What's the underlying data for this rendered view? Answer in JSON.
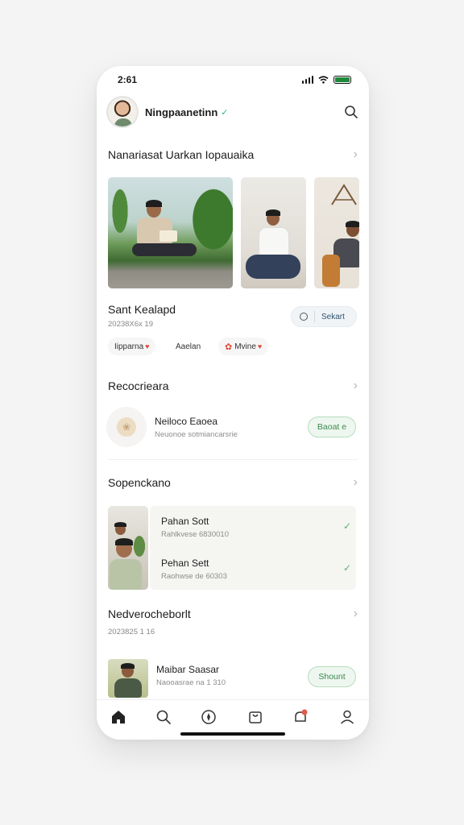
{
  "status_bar": {
    "time": "2:61"
  },
  "profile": {
    "name": "Ningpaanetinn",
    "verified_mark": "✓"
  },
  "section1": {
    "title": "Nanariasat Uarkan Iopauaika"
  },
  "event": {
    "title": "Sant Kealapd",
    "date": "20238X6x 19",
    "select_label": "Sekart"
  },
  "chips": [
    {
      "label": "Iipparna",
      "heart": "♥"
    },
    {
      "label": "Aaelan"
    },
    {
      "label": "Mvine",
      "heart": "♥"
    }
  ],
  "section2": {
    "title": "Recocrieara"
  },
  "recommendation": {
    "title": "Neiloco Eaoea",
    "subtitle": "Neuonoe sotmiancarsrie",
    "button": "Baoat e"
  },
  "section3": {
    "title": "Sopenckano"
  },
  "sp_items": [
    {
      "title": "Pahan Sott",
      "subtitle": "Rahlkvese 6830010"
    },
    {
      "title": "Pehan Sett",
      "subtitle": "Raohwse de 60303"
    }
  ],
  "section4": {
    "title": "Nedverocheborlt",
    "date": "2023825 1 16"
  },
  "last_item": {
    "title": "Maibar Saasar",
    "subtitle": "Naooasrae na 1 310",
    "button": "Shount"
  },
  "nav": [
    "home-icon",
    "search-icon",
    "compass-icon",
    "bag-icon",
    "bell-icon",
    "profile-icon"
  ],
  "colors": {
    "accent_green": "#2eb878",
    "heart_red": "#e04a3a"
  }
}
